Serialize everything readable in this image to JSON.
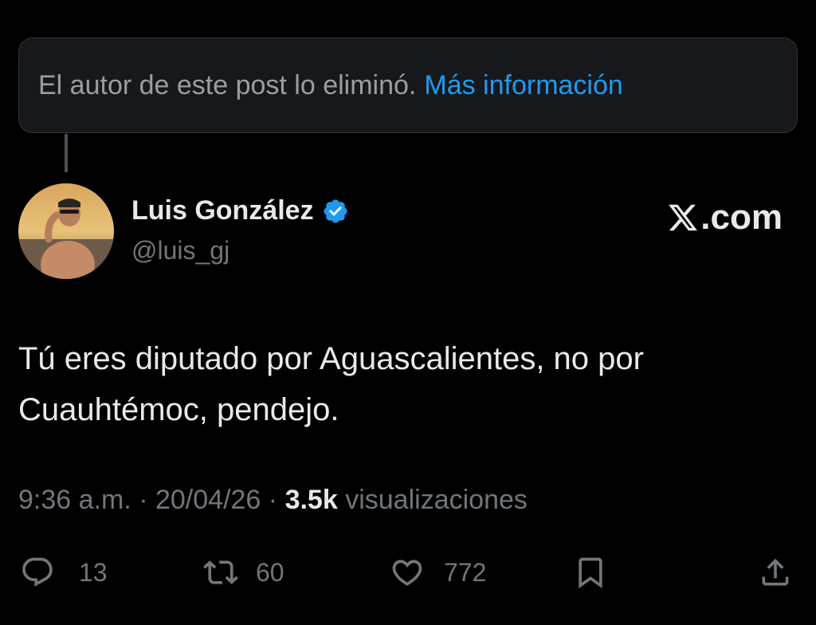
{
  "deleted_notice": {
    "message": "El autor de este post lo eliminó.",
    "link": "Más información"
  },
  "post": {
    "author_name": "Luis González",
    "handle": "@luis_gj",
    "verified": true,
    "brand": ".com",
    "text_line1": "Tú eres diputado por Aguascalientes, no por",
    "text_line2": "Cuauhtémoc, pendejo.",
    "time": "9:36 a.m.",
    "date": "20/04/26",
    "separator": "·",
    "views_count": "3.5k",
    "views_label": "visualizaciones"
  },
  "actions": {
    "replies": "13",
    "reposts": "60",
    "likes": "772"
  },
  "colors": {
    "background": "#000000",
    "link": "#1d9bf0",
    "verified": "#1d9bf0",
    "primary_text": "#e7e9ea",
    "secondary_text": "#71767b"
  }
}
